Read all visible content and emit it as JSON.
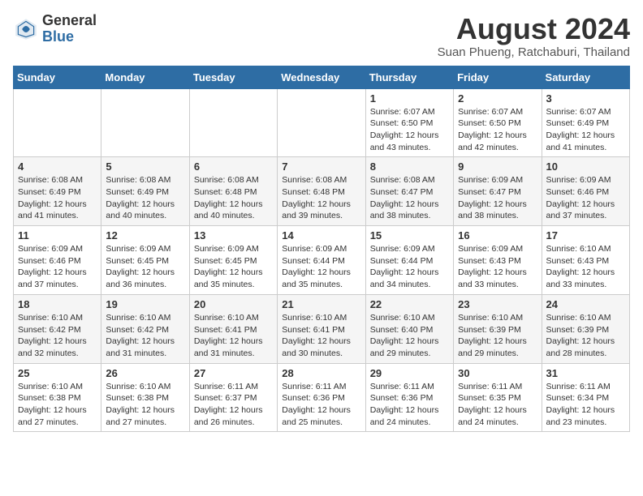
{
  "header": {
    "logo_general": "General",
    "logo_blue": "Blue",
    "month_year": "August 2024",
    "location": "Suan Phueng, Ratchaburi, Thailand"
  },
  "days_of_week": [
    "Sunday",
    "Monday",
    "Tuesday",
    "Wednesday",
    "Thursday",
    "Friday",
    "Saturday"
  ],
  "weeks": [
    [
      {
        "day": "",
        "info": ""
      },
      {
        "day": "",
        "info": ""
      },
      {
        "day": "",
        "info": ""
      },
      {
        "day": "",
        "info": ""
      },
      {
        "day": "1",
        "info": "Sunrise: 6:07 AM\nSunset: 6:50 PM\nDaylight: 12 hours\nand 43 minutes."
      },
      {
        "day": "2",
        "info": "Sunrise: 6:07 AM\nSunset: 6:50 PM\nDaylight: 12 hours\nand 42 minutes."
      },
      {
        "day": "3",
        "info": "Sunrise: 6:07 AM\nSunset: 6:49 PM\nDaylight: 12 hours\nand 41 minutes."
      }
    ],
    [
      {
        "day": "4",
        "info": "Sunrise: 6:08 AM\nSunset: 6:49 PM\nDaylight: 12 hours\nand 41 minutes."
      },
      {
        "day": "5",
        "info": "Sunrise: 6:08 AM\nSunset: 6:49 PM\nDaylight: 12 hours\nand 40 minutes."
      },
      {
        "day": "6",
        "info": "Sunrise: 6:08 AM\nSunset: 6:48 PM\nDaylight: 12 hours\nand 40 minutes."
      },
      {
        "day": "7",
        "info": "Sunrise: 6:08 AM\nSunset: 6:48 PM\nDaylight: 12 hours\nand 39 minutes."
      },
      {
        "day": "8",
        "info": "Sunrise: 6:08 AM\nSunset: 6:47 PM\nDaylight: 12 hours\nand 38 minutes."
      },
      {
        "day": "9",
        "info": "Sunrise: 6:09 AM\nSunset: 6:47 PM\nDaylight: 12 hours\nand 38 minutes."
      },
      {
        "day": "10",
        "info": "Sunrise: 6:09 AM\nSunset: 6:46 PM\nDaylight: 12 hours\nand 37 minutes."
      }
    ],
    [
      {
        "day": "11",
        "info": "Sunrise: 6:09 AM\nSunset: 6:46 PM\nDaylight: 12 hours\nand 37 minutes."
      },
      {
        "day": "12",
        "info": "Sunrise: 6:09 AM\nSunset: 6:45 PM\nDaylight: 12 hours\nand 36 minutes."
      },
      {
        "day": "13",
        "info": "Sunrise: 6:09 AM\nSunset: 6:45 PM\nDaylight: 12 hours\nand 35 minutes."
      },
      {
        "day": "14",
        "info": "Sunrise: 6:09 AM\nSunset: 6:44 PM\nDaylight: 12 hours\nand 35 minutes."
      },
      {
        "day": "15",
        "info": "Sunrise: 6:09 AM\nSunset: 6:44 PM\nDaylight: 12 hours\nand 34 minutes."
      },
      {
        "day": "16",
        "info": "Sunrise: 6:09 AM\nSunset: 6:43 PM\nDaylight: 12 hours\nand 33 minutes."
      },
      {
        "day": "17",
        "info": "Sunrise: 6:10 AM\nSunset: 6:43 PM\nDaylight: 12 hours\nand 33 minutes."
      }
    ],
    [
      {
        "day": "18",
        "info": "Sunrise: 6:10 AM\nSunset: 6:42 PM\nDaylight: 12 hours\nand 32 minutes."
      },
      {
        "day": "19",
        "info": "Sunrise: 6:10 AM\nSunset: 6:42 PM\nDaylight: 12 hours\nand 31 minutes."
      },
      {
        "day": "20",
        "info": "Sunrise: 6:10 AM\nSunset: 6:41 PM\nDaylight: 12 hours\nand 31 minutes."
      },
      {
        "day": "21",
        "info": "Sunrise: 6:10 AM\nSunset: 6:41 PM\nDaylight: 12 hours\nand 30 minutes."
      },
      {
        "day": "22",
        "info": "Sunrise: 6:10 AM\nSunset: 6:40 PM\nDaylight: 12 hours\nand 29 minutes."
      },
      {
        "day": "23",
        "info": "Sunrise: 6:10 AM\nSunset: 6:39 PM\nDaylight: 12 hours\nand 29 minutes."
      },
      {
        "day": "24",
        "info": "Sunrise: 6:10 AM\nSunset: 6:39 PM\nDaylight: 12 hours\nand 28 minutes."
      }
    ],
    [
      {
        "day": "25",
        "info": "Sunrise: 6:10 AM\nSunset: 6:38 PM\nDaylight: 12 hours\nand 27 minutes."
      },
      {
        "day": "26",
        "info": "Sunrise: 6:10 AM\nSunset: 6:38 PM\nDaylight: 12 hours\nand 27 minutes."
      },
      {
        "day": "27",
        "info": "Sunrise: 6:11 AM\nSunset: 6:37 PM\nDaylight: 12 hours\nand 26 minutes."
      },
      {
        "day": "28",
        "info": "Sunrise: 6:11 AM\nSunset: 6:36 PM\nDaylight: 12 hours\nand 25 minutes."
      },
      {
        "day": "29",
        "info": "Sunrise: 6:11 AM\nSunset: 6:36 PM\nDaylight: 12 hours\nand 24 minutes."
      },
      {
        "day": "30",
        "info": "Sunrise: 6:11 AM\nSunset: 6:35 PM\nDaylight: 12 hours\nand 24 minutes."
      },
      {
        "day": "31",
        "info": "Sunrise: 6:11 AM\nSunset: 6:34 PM\nDaylight: 12 hours\nand 23 minutes."
      }
    ]
  ]
}
